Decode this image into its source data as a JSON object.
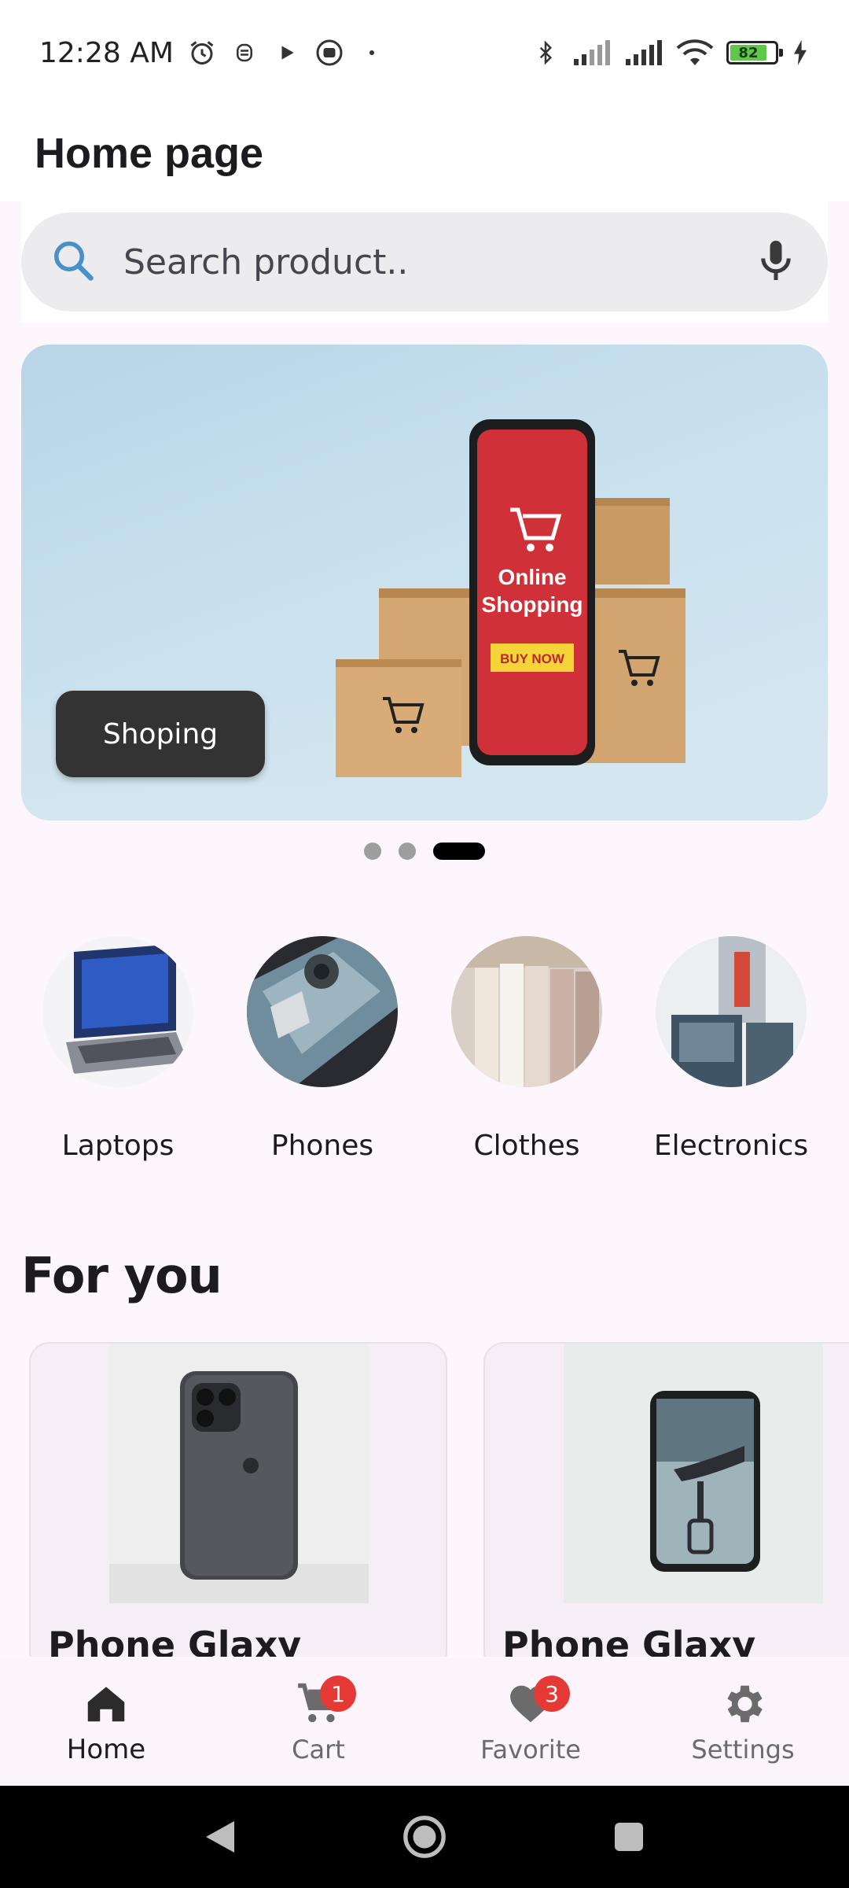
{
  "status_bar": {
    "time": "12:28 AM",
    "battery_level": "82",
    "icons": [
      "alarm-icon",
      "notification-icon",
      "play-icon",
      "media-icon",
      "dot-icon",
      "bluetooth-icon",
      "signal-icon",
      "signal-icon",
      "wifi-icon",
      "battery-icon",
      "charging-icon"
    ]
  },
  "app_bar": {
    "title": "Home page"
  },
  "search": {
    "placeholder": "Search product..",
    "value": ""
  },
  "banner": {
    "button_label": "Shoping",
    "slides": 3,
    "active_slide": 3,
    "art_text": {
      "line1": "Online",
      "line2": "Shopping",
      "cta": "BUY NOW"
    }
  },
  "categories": [
    {
      "label": "Laptops"
    },
    {
      "label": "Phones"
    },
    {
      "label": "Clothes"
    },
    {
      "label": "Electronics"
    }
  ],
  "for_you": {
    "title": "For you",
    "products": [
      {
        "title": "Phone Glaxy"
      },
      {
        "title": "Phone Glaxy"
      }
    ]
  },
  "bottom_nav": {
    "items": [
      {
        "label": "Home",
        "icon": "home-icon",
        "active": true
      },
      {
        "label": "Cart",
        "icon": "cart-icon",
        "badge": "1"
      },
      {
        "label": "Favorite",
        "icon": "heart-icon",
        "badge": "3"
      },
      {
        "label": "Settings",
        "icon": "gear-icon"
      }
    ]
  },
  "colors": {
    "background": "#fdf7fd",
    "badge": "#e53935",
    "banner_button": "#333333",
    "search_box": "#ecebee",
    "accent_search": "#4a90c8"
  }
}
